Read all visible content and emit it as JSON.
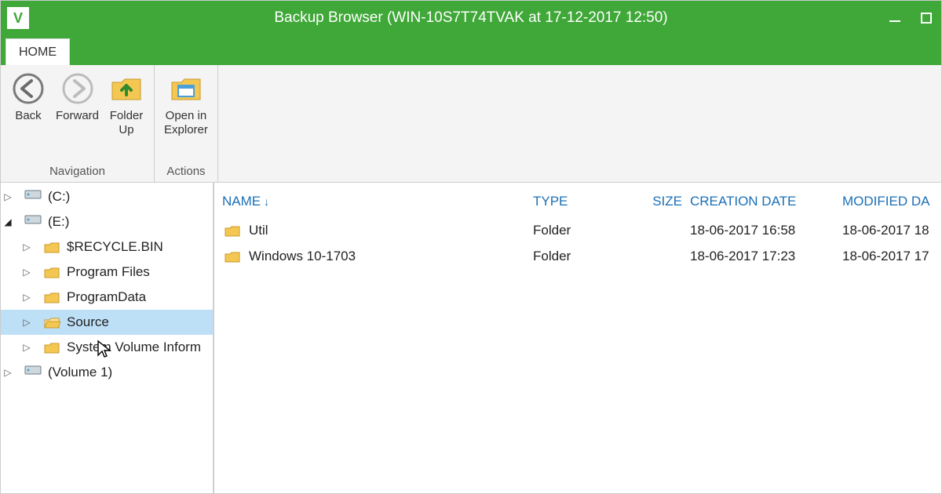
{
  "window": {
    "title": "Backup Browser (WIN-10S7T74TVAK at 17-12-2017 12:50)",
    "app_letter": "V",
    "tab_home": "HOME"
  },
  "ribbon": {
    "nav_group": "Navigation",
    "actions_group": "Actions",
    "back": "Back",
    "forward": "Forward",
    "folder_up": "Folder\nUp",
    "open_explorer": "Open in\nExplorer"
  },
  "tree": {
    "c": "(C:)",
    "e": "(E:)",
    "recycle": "$RECYCLE.BIN",
    "progfiles": "Program Files",
    "progdata": "ProgramData",
    "source": "Source",
    "svi": "System Volume Inform",
    "vol1": "(Volume 1)"
  },
  "columns": {
    "name": "NAME",
    "type": "TYPE",
    "size": "SIZE",
    "cdate": "CREATION DATE",
    "mdate": "MODIFIED DA"
  },
  "rows": [
    {
      "name": "Util",
      "type": "Folder",
      "size": "",
      "cdate": "18-06-2017 16:58",
      "mdate": "18-06-2017 18"
    },
    {
      "name": "Windows 10-1703",
      "type": "Folder",
      "size": "",
      "cdate": "18-06-2017 17:23",
      "mdate": "18-06-2017 17"
    }
  ]
}
